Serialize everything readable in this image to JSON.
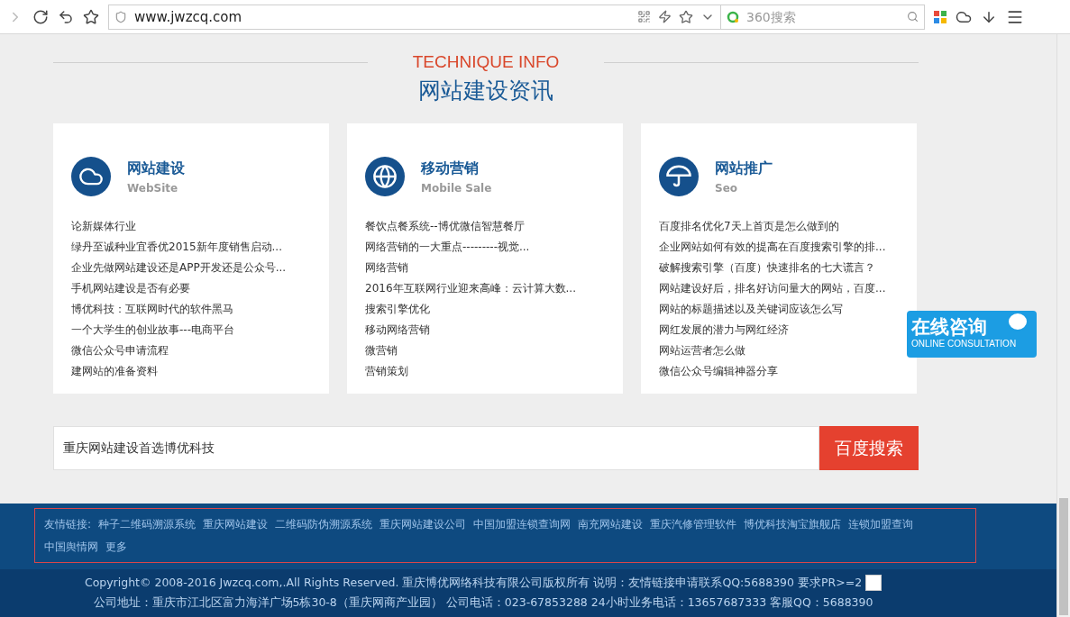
{
  "browser": {
    "url": "www.jwzcq.com",
    "search_placeholder": "360搜索"
  },
  "section": {
    "eyebrow": "TECHNIQUE INFO",
    "title": "网站建设资讯"
  },
  "cards": [
    {
      "kind": "cloud",
      "title": "网站建设",
      "subtitle": "WebSite",
      "links": [
        "论新媒体行业",
        "绿丹至诚种业宜香优2015新年度销售启动...",
        "企业先做网站建设还是APP开发还是公众号...",
        "手机网站建设是否有必要",
        "博优科技：互联网时代的软件黑马",
        "一个大学生的创业故事---电商平台",
        "微信公众号申请流程",
        "建网站的准备资料"
      ]
    },
    {
      "kind": "globe",
      "title": "移动营销",
      "subtitle": "Mobile Sale",
      "links": [
        "餐饮点餐系统--博优微信智慧餐厅",
        "网络营销的一大重点---------视觉...",
        "网络营销",
        "2016年互联网行业迎来高峰：云计算大数...",
        "搜索引擎优化",
        "移动网络营销",
        "微营销",
        "营销策划"
      ]
    },
    {
      "kind": "umbrella",
      "title": "网站推广",
      "subtitle": "Seo",
      "links": [
        "百度排名优化7天上首页是怎么做到的",
        "企业网站如何有效的提高在百度搜索引擎的排...",
        "破解搜索引擎（百度）快速排名的七大谎言？",
        "网站建设好后，排名好访问量大的网站，百度...",
        "网站的标题描述以及关键词应该怎么写",
        "网红发展的潜力与网红经济",
        "网站运营者怎么做",
        "微信公众号编辑神器分享"
      ]
    }
  ],
  "search": {
    "value": "重庆网站建设首选博优科技",
    "button": "百度搜索"
  },
  "consult": {
    "title": "在线咨询",
    "subtitle": "ONLINE CONSULTATION"
  },
  "footer": {
    "links_label": "友情链接:",
    "links": [
      "种子二维码溯源系统",
      "重庆网站建设",
      "二维码防伪溯源系统",
      "重庆网站建设公司",
      "中国加盟连锁查询网",
      "南充网站建设",
      "重庆汽修管理软件",
      "博优科技淘宝旗舰店",
      "连锁加盟查询",
      "中国舆情网",
      "更多"
    ],
    "copyright": "Copyright© 2008-2016 Jwzcq.com,.All Rights Reserved. 重庆博优网络科技有限公司版权所有 说明：友情链接申请联系QQ:5688390 要求PR>=2",
    "address": "公司地址：重庆市江北区富力海洋广场5栋30-8（重庆网商产业园） 公司电话：023-67853288 24小时业务电话：13657687333 客服QQ：5688390"
  }
}
